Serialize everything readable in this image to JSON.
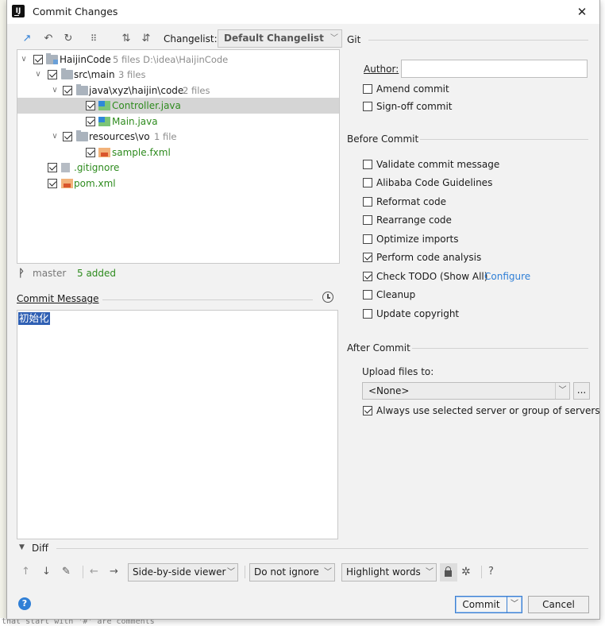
{
  "window": {
    "title": "Commit Changes",
    "close_glyph": "✕"
  },
  "toolbar": {
    "changelist_label": "Changelist:",
    "changelist_value": "Default Changelist"
  },
  "tree": [
    {
      "label": "HaijinCode",
      "meta": "5 files  D:\\idea\\HaijinCode"
    },
    {
      "label": "src\\main",
      "meta": "3 files"
    },
    {
      "label": "java\\xyz\\haijin\\code",
      "meta": "2 files"
    },
    {
      "label": "Controller.java",
      "meta": ""
    },
    {
      "label": "Main.java",
      "meta": ""
    },
    {
      "label": "resources\\vo",
      "meta": "1 file"
    },
    {
      "label": "sample.fxml",
      "meta": ""
    },
    {
      "label": ".gitignore",
      "meta": ""
    },
    {
      "label": "pom.xml",
      "meta": ""
    }
  ],
  "status": {
    "branch": "master",
    "changes": "5 added"
  },
  "commit_message": {
    "label": "Commit Message",
    "text": "初始化"
  },
  "git": {
    "section": "Git",
    "author_label": "Author:",
    "author_value": "",
    "amend": "Amend commit",
    "signoff": "Sign-off commit"
  },
  "before_commit": {
    "section": "Before Commit",
    "options": [
      {
        "label": "Validate commit message",
        "checked": false
      },
      {
        "label": "Alibaba Code Guidelines",
        "checked": false
      },
      {
        "label": "Reformat code",
        "checked": false
      },
      {
        "label": "Rearrange code",
        "checked": false
      },
      {
        "label": "Optimize imports",
        "checked": false
      },
      {
        "label": "Perform code analysis",
        "checked": true
      },
      {
        "label": "Check TODO (Show All)",
        "checked": true,
        "link": "Configure"
      },
      {
        "label": "Cleanup",
        "checked": false
      },
      {
        "label": "Update copyright",
        "checked": false
      }
    ]
  },
  "after_commit": {
    "section": "After Commit",
    "upload_label": "Upload files to:",
    "upload_value": "<None>",
    "more": "...",
    "always_use": "Always use selected server or group of servers"
  },
  "diff": {
    "label": "Diff",
    "viewer": "Side-by-side viewer",
    "whitespace": "Do not ignore",
    "highlight": "Highlight words"
  },
  "buttons": {
    "commit": "Commit",
    "cancel": "Cancel",
    "help": "?"
  },
  "background": {
    "bottom_text": "that start with '#' are comments"
  },
  "colors": {
    "accent": "#2f7fd6",
    "added": "#2e8b1e",
    "selection": "#2e5fb3"
  }
}
